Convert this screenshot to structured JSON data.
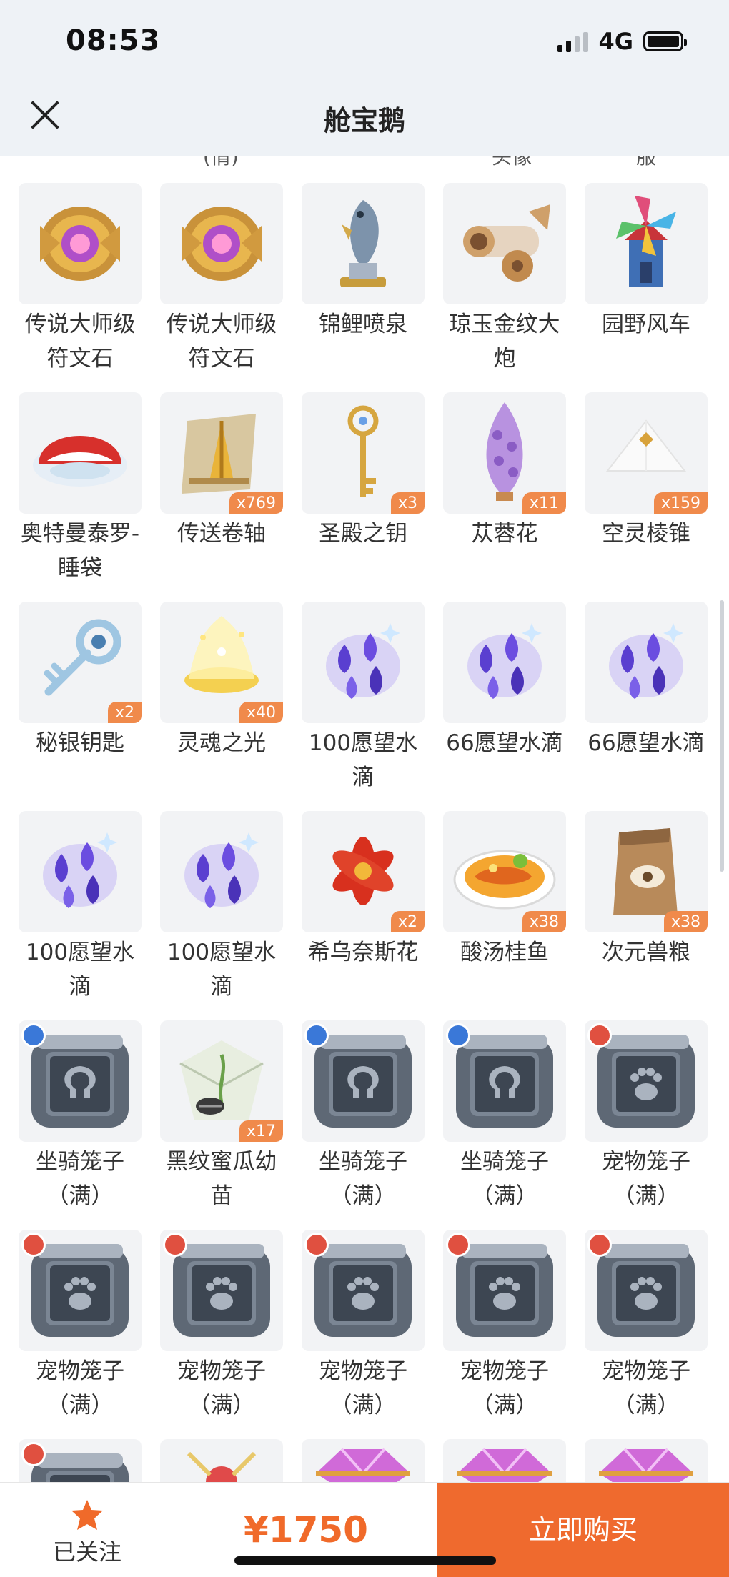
{
  "status": {
    "time": "08:53",
    "network": "4G"
  },
  "header": {
    "title": "舱宝鹅"
  },
  "cut_row": [
    "(情)",
    "头像",
    "服"
  ],
  "rows": [
    [
      {
        "name": "传说大师级符文石",
        "icon": "rune-stone",
        "qty": ""
      },
      {
        "name": "传说大师级符文石",
        "icon": "rune-stone",
        "qty": ""
      },
      {
        "name": "锦鲤喷泉",
        "icon": "koi-fountain",
        "qty": ""
      },
      {
        "name": "琼玉金纹大炮",
        "icon": "jade-cannon",
        "qty": ""
      },
      {
        "name": "园野风车",
        "icon": "windmill",
        "qty": ""
      }
    ],
    [
      {
        "name": "奥特曼泰罗-睡袋",
        "icon": "sleeping-bag",
        "qty": ""
      },
      {
        "name": "传送卷轴",
        "icon": "teleport-scroll",
        "qty": "x769"
      },
      {
        "name": "圣殿之钥",
        "icon": "temple-key",
        "qty": "x3"
      },
      {
        "name": "苁蓉花",
        "icon": "cistanche-flower",
        "qty": "x11"
      },
      {
        "name": "空灵棱锥",
        "icon": "ethereal-pyramid",
        "qty": "x159"
      }
    ],
    [
      {
        "name": "秘银钥匙",
        "icon": "mithril-key",
        "qty": "x2"
      },
      {
        "name": "灵魂之光",
        "icon": "soul-light",
        "qty": "x40"
      },
      {
        "name": "100愿望水滴",
        "icon": "wish-drops",
        "qty": ""
      },
      {
        "name": "66愿望水滴",
        "icon": "wish-drops",
        "qty": ""
      },
      {
        "name": "66愿望水滴",
        "icon": "wish-drops",
        "qty": ""
      }
    ],
    [
      {
        "name": "100愿望水滴",
        "icon": "wish-drops",
        "qty": ""
      },
      {
        "name": "100愿望水滴",
        "icon": "wish-drops",
        "qty": ""
      },
      {
        "name": "希乌奈斯花",
        "icon": "red-flower",
        "qty": "x2"
      },
      {
        "name": "酸汤桂鱼",
        "icon": "fish-soup",
        "qty": "x38"
      },
      {
        "name": "次元兽粮",
        "icon": "pet-food-bag",
        "qty": "x38"
      }
    ],
    [
      {
        "name": "坐骑笼子（满）",
        "icon": "mount-cage",
        "qty": ""
      },
      {
        "name": "黑纹蜜瓜幼苗",
        "icon": "seed-packet",
        "qty": "x17"
      },
      {
        "name": "坐骑笼子（满）",
        "icon": "mount-cage",
        "qty": ""
      },
      {
        "name": "坐骑笼子（满）",
        "icon": "mount-cage",
        "qty": ""
      },
      {
        "name": "宠物笼子（满）",
        "icon": "pet-cage",
        "qty": ""
      }
    ],
    [
      {
        "name": "宠物笼子（满）",
        "icon": "pet-cage",
        "qty": ""
      },
      {
        "name": "宠物笼子（满）",
        "icon": "pet-cage",
        "qty": ""
      },
      {
        "name": "宠物笼子（满）",
        "icon": "pet-cage",
        "qty": ""
      },
      {
        "name": "宠物笼子（满）",
        "icon": "pet-cage",
        "qty": ""
      },
      {
        "name": "宠物笼子（满）",
        "icon": "pet-cage",
        "qty": ""
      }
    ],
    [
      {
        "name": "",
        "icon": "pet-cage",
        "qty": ""
      },
      {
        "name": "",
        "icon": "gift-item",
        "qty": ""
      },
      {
        "name": "",
        "icon": "pink-gem",
        "qty": ""
      },
      {
        "name": "",
        "icon": "pink-gem",
        "qty": ""
      },
      {
        "name": "",
        "icon": "pink-gem",
        "qty": ""
      }
    ]
  ],
  "bottom": {
    "follow_label": "已关注",
    "price": "¥1750",
    "buy_label": "立即购买"
  },
  "colors": {
    "accent": "#ef6a2e",
    "header_bg": "#eef2f6",
    "tile_bg": "#f2f3f5"
  }
}
